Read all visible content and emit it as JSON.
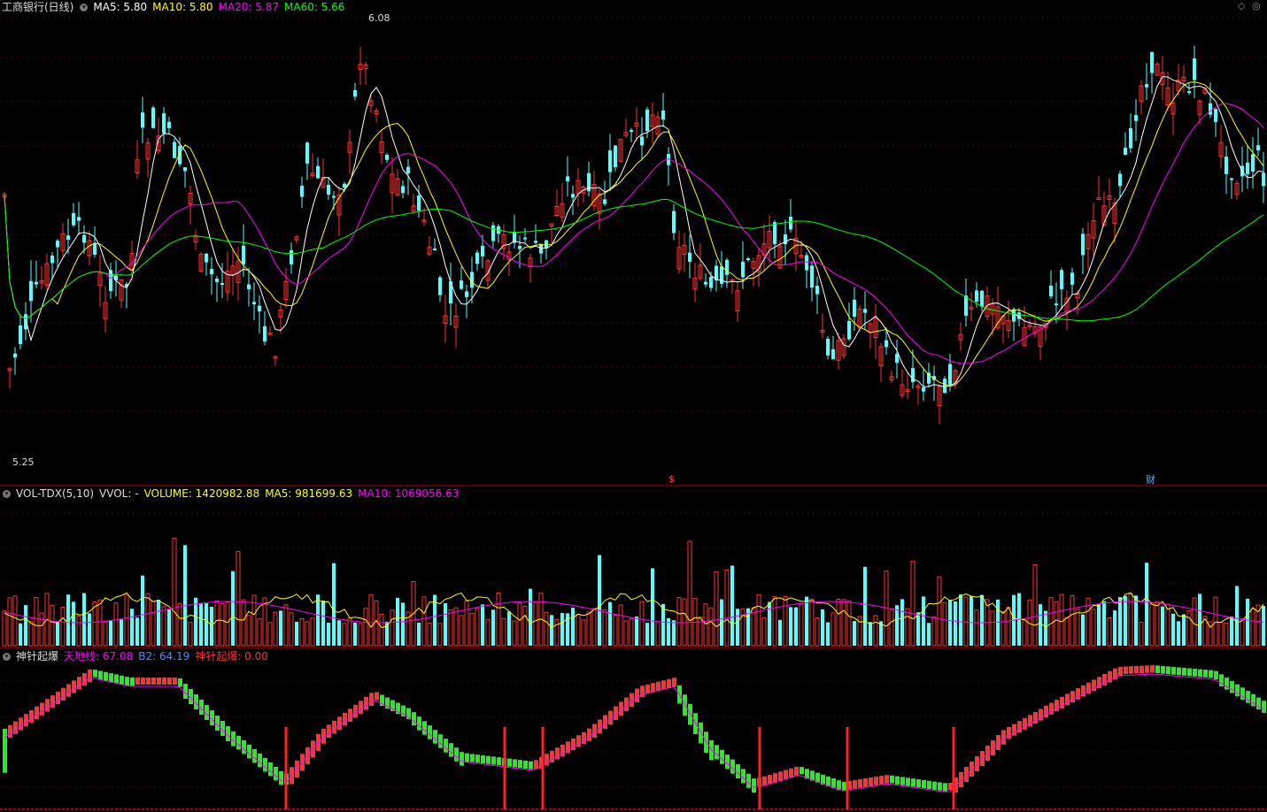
{
  "panel_main": {
    "title": "工商银行(日线)",
    "indicators": [
      {
        "label": "MA5: 5.80",
        "color": "#ffffff"
      },
      {
        "label": "MA10: 5.80",
        "color": "#ffff00"
      },
      {
        "label": "MA20: 5.87",
        "color": "#ff00ff"
      },
      {
        "label": "MA60: 5.66",
        "color": "#00ff00"
      }
    ],
    "high_label": "6.08",
    "low_label": "5.25",
    "marker_s": "$",
    "marker_cai": "财"
  },
  "panel_vol": {
    "title": "VOL-TDX(5,10)",
    "vvol": "VVOL: -",
    "indicators": [
      {
        "label": "VOLUME: 1420982.88",
        "color": "#ffff00"
      },
      {
        "label": "MA5: 981699.63",
        "color": "#ffff00"
      },
      {
        "label": "MA10: 1069056.63",
        "color": "#ff00ff"
      }
    ]
  },
  "panel_osc": {
    "title": "神针起爆",
    "indicators": [
      {
        "label": "天地线: 67.08",
        "color": "#ff00ff"
      },
      {
        "label": "B2: 64.19",
        "color": "#5588ff"
      },
      {
        "label": "神针起爆: 0.00",
        "color": "#ff3333"
      }
    ]
  },
  "corner_icons": [
    "diamond-icon",
    "settings-icon"
  ],
  "colors": {
    "up": "#ff3333",
    "down": "#55ffff",
    "grid": "#5a0000"
  }
}
